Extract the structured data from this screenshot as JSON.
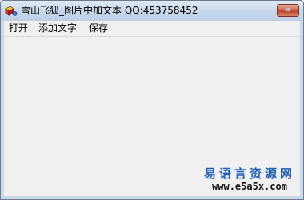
{
  "window": {
    "title": "雪山飞狐_图片中加文本  QQ:453758452",
    "app_icon": "app-icon",
    "close_label": "✕"
  },
  "menu": {
    "items": [
      {
        "label": "打开"
      },
      {
        "label": "添加文字"
      },
      {
        "label": "保存"
      }
    ]
  },
  "watermark": {
    "title": "易语言资源网",
    "url": "www.e5a5x.com"
  },
  "colors": {
    "titlebar": "#c6d7ea",
    "client": "#f0f0f0",
    "close_button": "#c0432c",
    "watermark_title": "#1f5fb8"
  }
}
